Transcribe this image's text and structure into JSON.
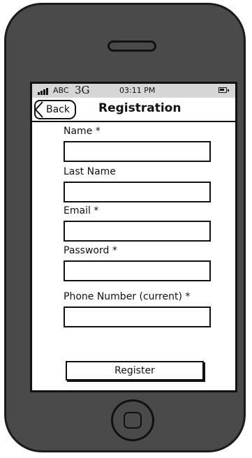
{
  "status_bar": {
    "carrier": "ABC",
    "network": "3G",
    "time": "03:11 PM",
    "icons": [
      "signal-icon",
      "battery-icon"
    ]
  },
  "nav": {
    "back_label": "Back",
    "title": "Registration"
  },
  "form": {
    "fields": [
      {
        "label": "Name *",
        "value": "",
        "placeholder": ""
      },
      {
        "label": "Last Name",
        "value": "",
        "placeholder": ""
      },
      {
        "label": "Email *",
        "value": "",
        "placeholder": ""
      },
      {
        "label": "Password *",
        "value": "",
        "placeholder": ""
      },
      {
        "label": "Phone Number (current) *",
        "value": "",
        "placeholder": ""
      }
    ],
    "submit_label": "Register"
  },
  "colors": {
    "device_body": "#4a4a4a",
    "status_bar_bg": "#d6d6d6",
    "outline": "#111111"
  }
}
